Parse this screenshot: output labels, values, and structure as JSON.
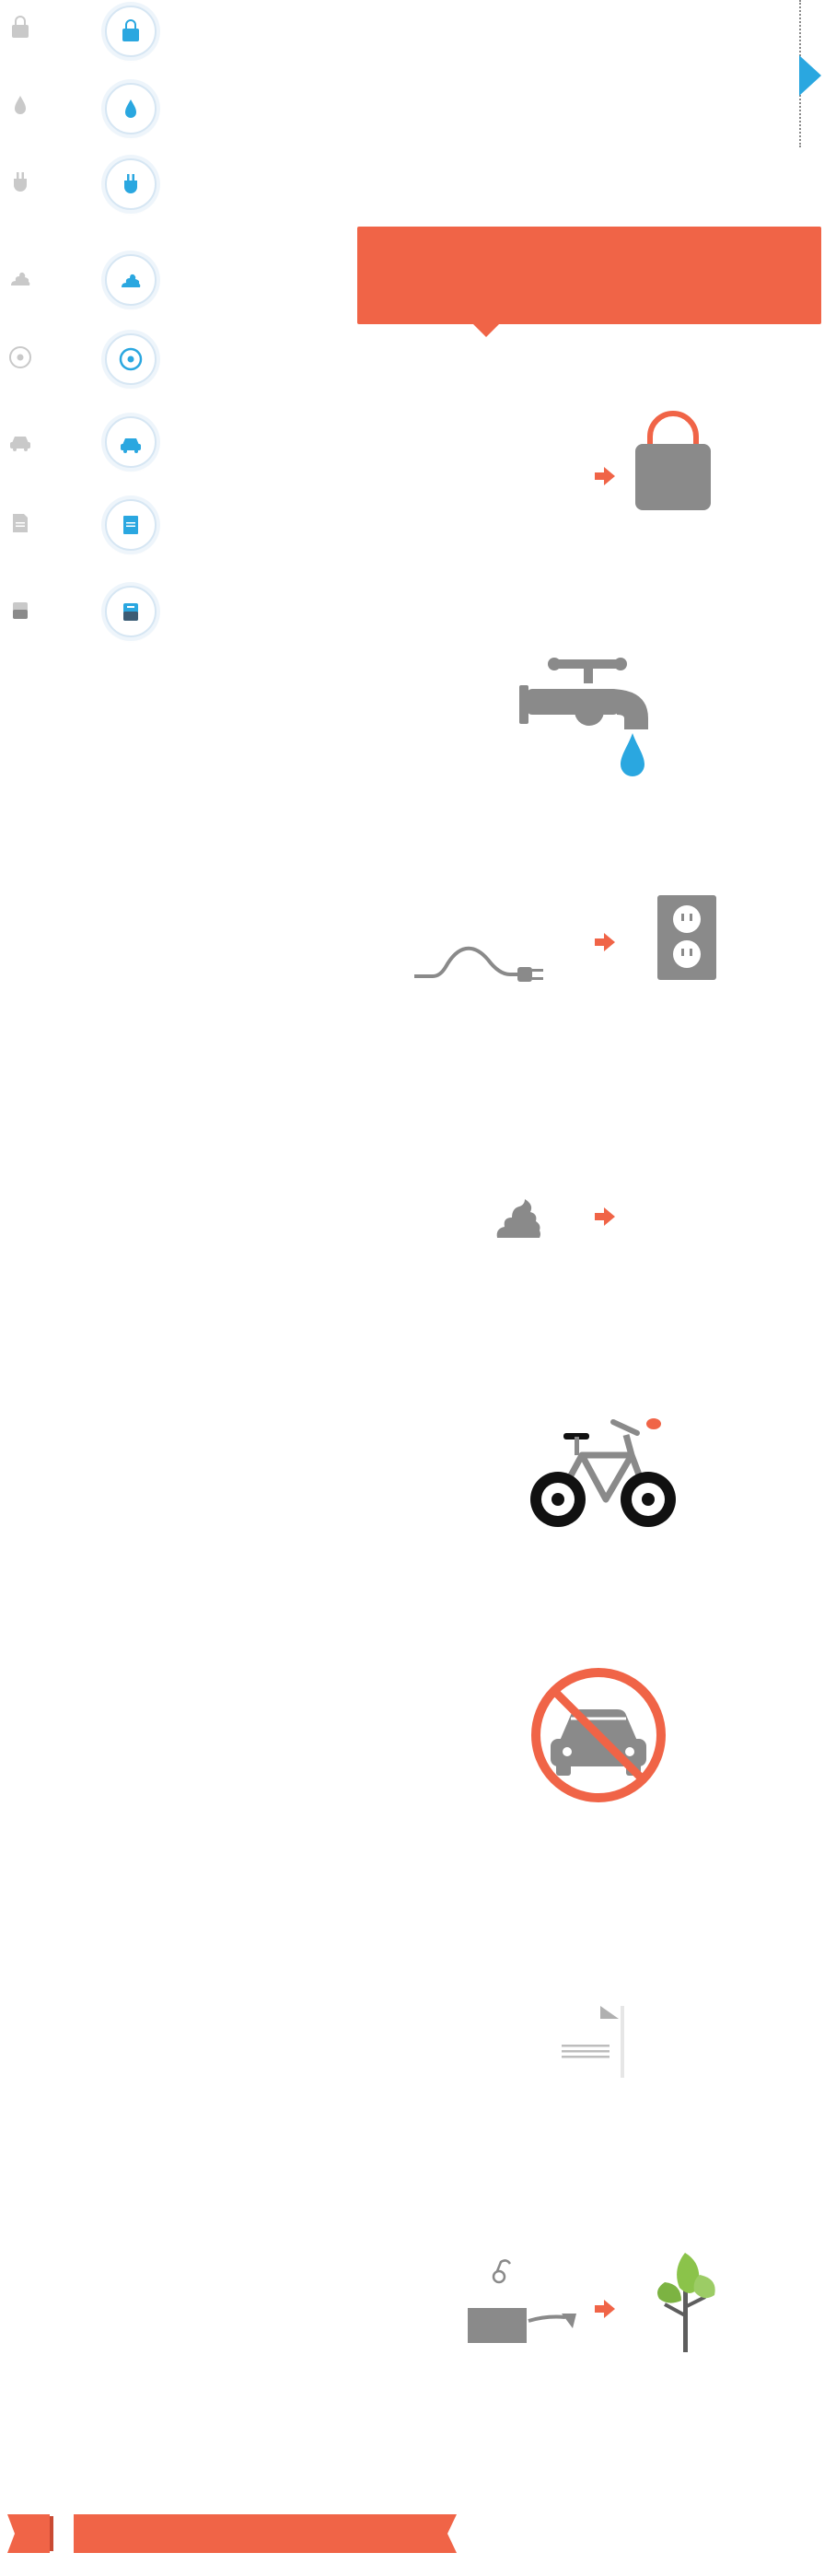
{
  "colors": {
    "accent": "#f06447",
    "icon_gray": "#8a8a8a",
    "icon_blue": "#2aa7e0",
    "leaf_green": "#8bc34a"
  },
  "sidebar": {
    "items": [
      {
        "name": "bag",
        "icon": "shopping-bag-icon"
      },
      {
        "name": "water",
        "icon": "water-drop-icon"
      },
      {
        "name": "plug",
        "icon": "plug-icon"
      },
      {
        "name": "poop",
        "icon": "poop-icon"
      },
      {
        "name": "target",
        "icon": "target-icon"
      },
      {
        "name": "car",
        "icon": "car-icon"
      },
      {
        "name": "paper",
        "icon": "paper-icon"
      },
      {
        "name": "battery",
        "icon": "battery-icon"
      }
    ]
  },
  "banner": {
    "text": ""
  },
  "scenes": [
    {
      "name": "bag",
      "icons": [
        "arrow-icon",
        "shopping-bag-icon"
      ]
    },
    {
      "name": "faucet",
      "icons": [
        "faucet-icon",
        "water-drop-icon"
      ]
    },
    {
      "name": "plug",
      "icons": [
        "cord-icon",
        "arrow-icon",
        "outlet-icon"
      ]
    },
    {
      "name": "poop",
      "icons": [
        "poop-icon",
        "arrow-icon"
      ]
    },
    {
      "name": "bike",
      "icons": [
        "bicycle-icon"
      ]
    },
    {
      "name": "no-car",
      "icons": [
        "no-car-icon"
      ]
    },
    {
      "name": "paper",
      "icons": [
        "paper-sheet-icon"
      ]
    },
    {
      "name": "recycle",
      "icons": [
        "laptop-icon",
        "arrow-icon",
        "tree-icon"
      ]
    }
  ]
}
